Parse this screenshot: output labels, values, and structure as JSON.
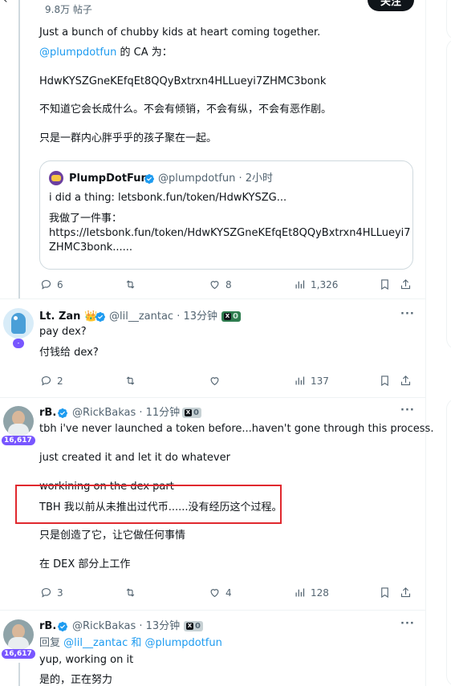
{
  "top": {
    "posts_count": "9.8万 帖子",
    "follow_button": "关注"
  },
  "main_post": {
    "line1": "Just a bunch of chubby kids at heart coming together.",
    "ca_mention": "@plumpdotfun",
    "ca_suffix": " 的 CA 为：",
    "ca": "HdwKYSZGneKEfqEt8QQyBxtrxn4HLLueyi7ZHMC3bonk",
    "line_zh1": "不知道它会长成什么。不会有倾销，不会有纵，不会有恶作剧。",
    "line_zh2": "只是一群内心胖乎乎的孩子聚在一起。",
    "quote": {
      "name": "PlumpDotFun",
      "handle": "@plumpdotfun · 2小时",
      "text1": "i did a thing: letsbonk.fun/token/HdwKYSZG...",
      "text2": "我做了一件事：",
      "text3": "https://letsbonk.fun/token/HdwKYSZGneKEfqEt8QQyBxtrxn4HLLueyi7",
      "text4": "ZHMC3bonk......"
    },
    "stats": {
      "replies": "6",
      "reposts": "",
      "likes": "8",
      "views": "1,326"
    }
  },
  "replies": [
    {
      "name": "Lt. Zan",
      "emoji": "👑",
      "handle": "@lil__zantac · 13分钟",
      "badge": "0",
      "lines": [
        "pay dex?",
        "付钱给 dex?"
      ],
      "stats": {
        "replies": "2",
        "reposts": "",
        "likes": "",
        "views": "137"
      }
    },
    {
      "name": "rB.",
      "handle": "@RickBakas · 11分钟",
      "badge": "0",
      "followers": "16,617",
      "lines": [
        "tbh i've never launched a token before...haven't gone through this process.",
        "just created it and let it do whatever",
        "workining on the dex part",
        "TBH 我以前从未推出过代币......没有经历这个过程。",
        "只是创造了它，让它做任何事情",
        "在 DEX 部分上工作"
      ],
      "stats": {
        "replies": "3",
        "reposts": "",
        "likes": "4",
        "views": "128"
      }
    },
    {
      "name": "rB.",
      "handle": "@RickBakas · 13分钟",
      "badge": "0",
      "followers": "16,617",
      "reply_prefix": "回复 ",
      "reply_to1": "@lil__zantac",
      "reply_and": " 和 ",
      "reply_to2": "@plumpdotfun",
      "lines": [
        "yup, working on it",
        "是的，正在努力"
      ]
    }
  ],
  "colors": {
    "accent": "#1d9bf0",
    "highlight": "#e0282e",
    "badge_purple": "#7856ff"
  }
}
